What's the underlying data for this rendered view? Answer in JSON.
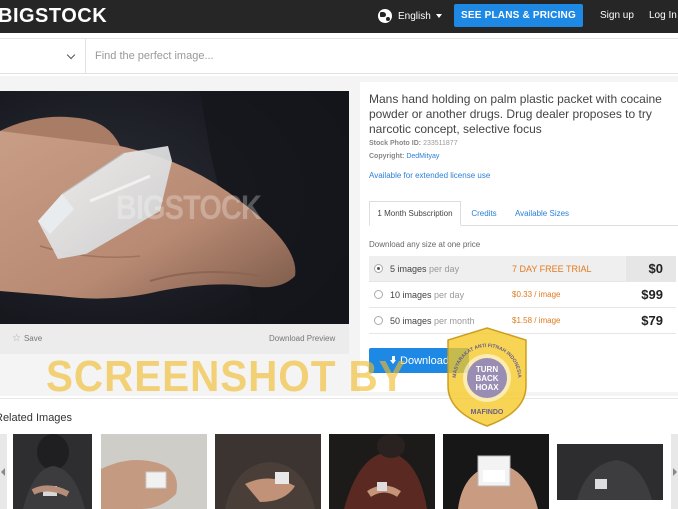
{
  "header": {
    "logo": "BIGSTOCK",
    "language": "English",
    "plans_button": "SEE PLANS & PRICING",
    "signup": "Sign up",
    "login": "Log In"
  },
  "search": {
    "placeholder": "Find the perfect image..."
  },
  "photo": {
    "watermark": "BIGSTOCK",
    "save_label": "Save",
    "download_preview": "Download Preview"
  },
  "details": {
    "title": "Mans hand holding on palm plastic packet with cocaine powder or another drugs. Drug dealer proposes to try narcotic concept, selective focus",
    "stock_id_label": "Stock Photo ID:",
    "stock_id": "233511877",
    "copyright_label": "Copyright:",
    "copyright": "DedMityay",
    "extended_license": "Available for extended license use"
  },
  "tabs": [
    "1 Month Subscription",
    "Credits",
    "Available Sizes"
  ],
  "download_any": "Download any size at one price",
  "pricing": [
    {
      "count": "5 images",
      "unit": "per day",
      "deal": "7 DAY FREE TRIAL",
      "price": "$0",
      "selected": true
    },
    {
      "count": "10 images",
      "unit": "per day",
      "deal": "$0.33 / image",
      "price": "$99",
      "selected": false
    },
    {
      "count": "50 images",
      "unit": "per month",
      "deal": "$1.58 / image",
      "price": "$79",
      "selected": false
    }
  ],
  "download_button": "Download",
  "related": {
    "title": "Related Images"
  },
  "overlay": {
    "screenshot_text": "SCREENSHOT BY",
    "badge_top": "MASYARAKAT ANTI FITNAH INDONESIA",
    "badge_center": [
      "TURN",
      "BACK",
      "HOAX"
    ],
    "badge_bottom": "MAFINDO"
  },
  "colors": {
    "topbar": "#262626",
    "accent_blue": "#1e88e5",
    "deal_orange": "#e07b1f",
    "watermark_yellow": "#f0b928"
  },
  "icons": {
    "globe": "globe-icon",
    "star": "star-icon",
    "download": "download-icon",
    "chevron": "chevron-down-icon"
  }
}
